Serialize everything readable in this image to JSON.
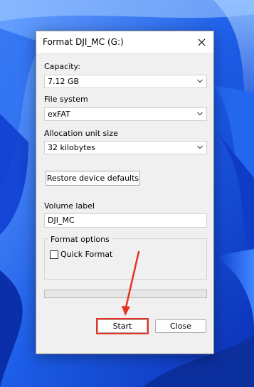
{
  "dialog": {
    "title": "Format DJI_MC (G:)",
    "capacity": {
      "label": "Capacity:",
      "value": "7.12 GB"
    },
    "file_system": {
      "label": "File system",
      "value": "exFAT"
    },
    "allocation": {
      "label": "Allocation unit size",
      "value": "32 kilobytes"
    },
    "restore_button": "Restore device defaults",
    "volume": {
      "label": "Volume label",
      "value": "DJI_MC"
    },
    "format_options": {
      "title": "Format options",
      "quick_format_label": "Quick Format",
      "quick_format_checked": false
    },
    "progress": 0,
    "start_button": "Start",
    "close_button": "Close"
  },
  "colors": {
    "annotation": "#e8321f",
    "wallpaper": "#1a5fe6"
  },
  "icons": [
    "close-icon",
    "chevron-down-icon",
    "annotation-arrow"
  ]
}
